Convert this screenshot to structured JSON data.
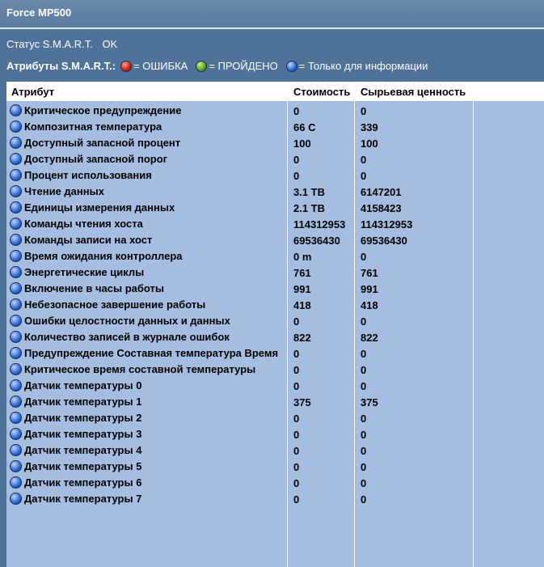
{
  "window": {
    "title": "Force MP500"
  },
  "status": {
    "label": "Статус S.M.A.R.T.",
    "value": "OK"
  },
  "legend": {
    "label": "Атрибуты S.M.A.R.T.:",
    "error": "= ОШИБКА",
    "passed": "= ПРОЙДЕНО",
    "info": "= Только для информации"
  },
  "table": {
    "headers": [
      "Атрибут",
      "Стоимость",
      "Сырьевая ценность"
    ],
    "rows": [
      {
        "name": "Критическое предупреждение",
        "value": "0",
        "raw": "0"
      },
      {
        "name": "Композитная температура",
        "value": "66 C",
        "raw": "339"
      },
      {
        "name": "Доступный запасной процент",
        "value": "100",
        "raw": "100"
      },
      {
        "name": "Доступный запасной порог",
        "value": "0",
        "raw": "0"
      },
      {
        "name": "Процент использования",
        "value": "0",
        "raw": "0"
      },
      {
        "name": "Чтение данных",
        "value": "3.1 TB",
        "raw": "6147201"
      },
      {
        "name": "Единицы измерения данных",
        "value": "2.1 TB",
        "raw": "4158423"
      },
      {
        "name": "Команды чтения хоста",
        "value": "114312953",
        "raw": "114312953"
      },
      {
        "name": "Команды записи на хост",
        "value": "69536430",
        "raw": "69536430"
      },
      {
        "name": "Время ожидания контроллера",
        "value": "0 m",
        "raw": "0"
      },
      {
        "name": "Энергетические циклы",
        "value": "761",
        "raw": "761"
      },
      {
        "name": "Включение в часы работы",
        "value": "991",
        "raw": "991"
      },
      {
        "name": "Небезопасное завершение работы",
        "value": "418",
        "raw": "418"
      },
      {
        "name": "Ошибки целостности данных и данных",
        "value": "0",
        "raw": "0"
      },
      {
        "name": "Количество записей в журнале ошибок",
        "value": "822",
        "raw": "822"
      },
      {
        "name": "Предупреждение Составная температура Время",
        "value": "0",
        "raw": "0"
      },
      {
        "name": "Критическое время составной температуры",
        "value": "0",
        "raw": "0"
      },
      {
        "name": "Датчик температуры 0",
        "value": "0",
        "raw": "0"
      },
      {
        "name": "Датчик температуры 1",
        "value": "375",
        "raw": "375"
      },
      {
        "name": "Датчик температуры 2",
        "value": "0",
        "raw": "0"
      },
      {
        "name": "Датчик температуры 3",
        "value": "0",
        "raw": "0"
      },
      {
        "name": "Датчик температуры 4",
        "value": "0",
        "raw": "0"
      },
      {
        "name": "Датчик температуры 5",
        "value": "0",
        "raw": "0"
      },
      {
        "name": "Датчик температуры 6",
        "value": "0",
        "raw": "0"
      },
      {
        "name": "Датчик температуры 7",
        "value": "0",
        "raw": "0"
      }
    ]
  }
}
